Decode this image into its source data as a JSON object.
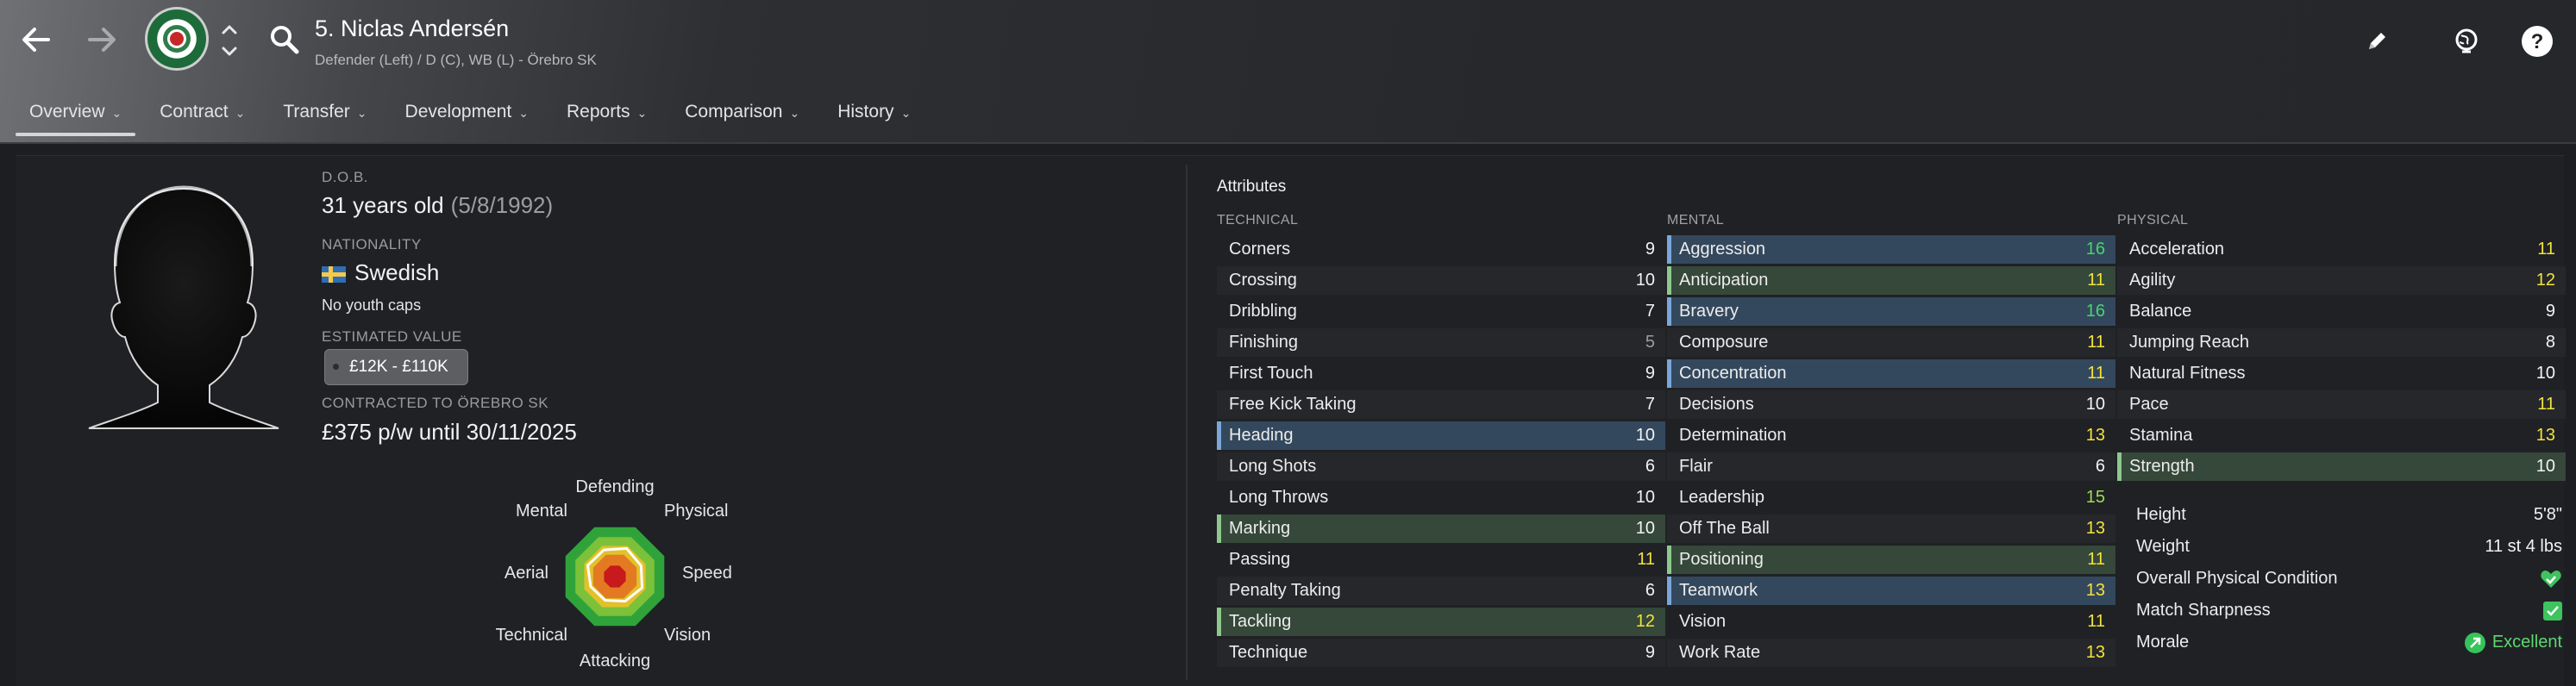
{
  "header": {
    "player_name": "5. Niclas Andersén",
    "subtitle": "Defender (Left) / D (C), WB (L) - Örebro SK",
    "tabs": [
      {
        "label": "Overview"
      },
      {
        "label": "Contract"
      },
      {
        "label": "Transfer"
      },
      {
        "label": "Development"
      },
      {
        "label": "Reports"
      },
      {
        "label": "Comparison"
      },
      {
        "label": "History"
      }
    ],
    "icons": [
      "back-arrow-icon",
      "forward-arrow-icon",
      "club-badge",
      "chevron-up-down-icon",
      "search-icon",
      "edit-pencil-icon",
      "scout-globe-icon",
      "help-icon"
    ]
  },
  "profile": {
    "dob_label": "D.O.B.",
    "age": "31 years old",
    "dob": "(5/8/1992)",
    "nationality_label": "NATIONALITY",
    "nationality": "Swedish",
    "youth_caps": "No youth caps",
    "value_label": "ESTIMATED VALUE",
    "value": "£12K - £110K",
    "contract_label": "CONTRACTED TO ÖREBRO SK",
    "contract": "£375 p/w until 30/11/2025"
  },
  "radar": {
    "labels": {
      "defending": "Defending",
      "physical": "Physical",
      "speed": "Speed",
      "vision": "Vision",
      "attacking": "Attacking",
      "technical": "Technical",
      "aerial": "Aerial",
      "mental": "Mental"
    },
    "values": {
      "defending": 0.57,
      "physical": 0.53,
      "speed": 0.55,
      "vision": 0.5,
      "attacking": 0.48,
      "technical": 0.49,
      "aerial": 0.55,
      "mental": 0.54
    }
  },
  "attributes": {
    "title": "Attributes",
    "technical": {
      "label": "TECHNICAL",
      "rows": [
        {
          "name": "Corners",
          "value": "9"
        },
        {
          "name": "Crossing",
          "value": "10"
        },
        {
          "name": "Dribbling",
          "value": "7"
        },
        {
          "name": "Finishing",
          "value": "5"
        },
        {
          "name": "First Touch",
          "value": "9"
        },
        {
          "name": "Free Kick Taking",
          "value": "7"
        },
        {
          "name": "Heading",
          "value": "10"
        },
        {
          "name": "Long Shots",
          "value": "6"
        },
        {
          "name": "Long Throws",
          "value": "10"
        },
        {
          "name": "Marking",
          "value": "10"
        },
        {
          "name": "Passing",
          "value": "11"
        },
        {
          "name": "Penalty Taking",
          "value": "6"
        },
        {
          "name": "Tackling",
          "value": "12"
        },
        {
          "name": "Technique",
          "value": "9"
        }
      ]
    },
    "mental": {
      "label": "MENTAL",
      "rows": [
        {
          "name": "Aggression",
          "value": "16"
        },
        {
          "name": "Anticipation",
          "value": "11"
        },
        {
          "name": "Bravery",
          "value": "16"
        },
        {
          "name": "Composure",
          "value": "11"
        },
        {
          "name": "Concentration",
          "value": "11"
        },
        {
          "name": "Decisions",
          "value": "10"
        },
        {
          "name": "Determination",
          "value": "13"
        },
        {
          "name": "Flair",
          "value": "6"
        },
        {
          "name": "Leadership",
          "value": "15"
        },
        {
          "name": "Off The Ball",
          "value": "13"
        },
        {
          "name": "Positioning",
          "value": "11"
        },
        {
          "name": "Teamwork",
          "value": "13"
        },
        {
          "name": "Vision",
          "value": "11"
        },
        {
          "name": "Work Rate",
          "value": "13"
        }
      ]
    },
    "physical": {
      "label": "PHYSICAL",
      "rows": [
        {
          "name": "Acceleration",
          "value": "11"
        },
        {
          "name": "Agility",
          "value": "12"
        },
        {
          "name": "Balance",
          "value": "9"
        },
        {
          "name": "Jumping Reach",
          "value": "8"
        },
        {
          "name": "Natural Fitness",
          "value": "10"
        },
        {
          "name": "Pace",
          "value": "11"
        },
        {
          "name": "Stamina",
          "value": "13"
        },
        {
          "name": "Strength",
          "value": "10"
        }
      ]
    }
  },
  "info": {
    "height_label": "Height",
    "height": "5'8\"",
    "weight_label": "Weight",
    "weight": "11 st 4 lbs",
    "condition_label": "Overall Physical Condition",
    "sharpness_label": "Match Sharpness",
    "morale_label": "Morale",
    "morale": "Excellent"
  },
  "colors": {
    "highlight_blue": "#34485d",
    "highlight_green": "#354839",
    "value_yellow": "#f2e23c",
    "value_green": "#46d46e",
    "radar_outer": "#2faa3b",
    "radar_inner": "#c8191d"
  }
}
